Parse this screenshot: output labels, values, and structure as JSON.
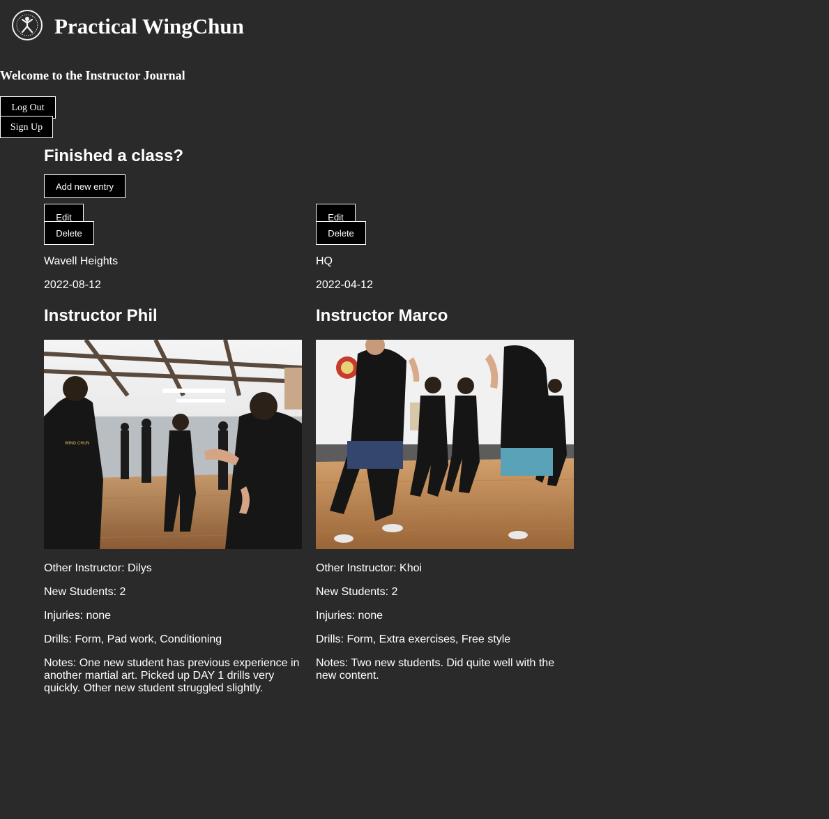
{
  "header": {
    "site_title": "Practical WingChun",
    "logo_icon": "wingchun-logo-icon"
  },
  "welcome": "Welcome to the Instructor Journal",
  "auth": {
    "logout_label": "Log Out",
    "signup_label": "Sign Up"
  },
  "journal": {
    "heading": "Finished a class?",
    "add_label": "Add new entry",
    "entries": [
      {
        "edit_label": "Edit",
        "delete_label": "Delete",
        "location": "Wavell Heights",
        "date": "2022-08-12",
        "instructor": "Instructor Phil",
        "other_instructor": "Other Instructor: Dilys",
        "new_students": "New Students: 2",
        "injuries": "Injuries: none",
        "drills": "Drills: Form, Pad work, Conditioning",
        "notes": "Notes: One new student has previous experience in another martial art. Picked up DAY 1 drills very quickly. Other new student struggled slightly."
      },
      {
        "edit_label": "Edit",
        "delete_label": "Delete",
        "location": "HQ",
        "date": "2022-04-12",
        "instructor": "Instructor Marco",
        "other_instructor": "Other Instructor: Khoi",
        "new_students": "New Students: 2",
        "injuries": "Injuries: none",
        "drills": "Drills: Form, Extra exercises, Free style",
        "notes": "Notes: Two new students. Did quite well with the new content."
      }
    ]
  },
  "colors": {
    "background": "#2a2a2a",
    "button_bg": "#000000",
    "button_border": "#ffffff",
    "text": "#ffffff"
  }
}
